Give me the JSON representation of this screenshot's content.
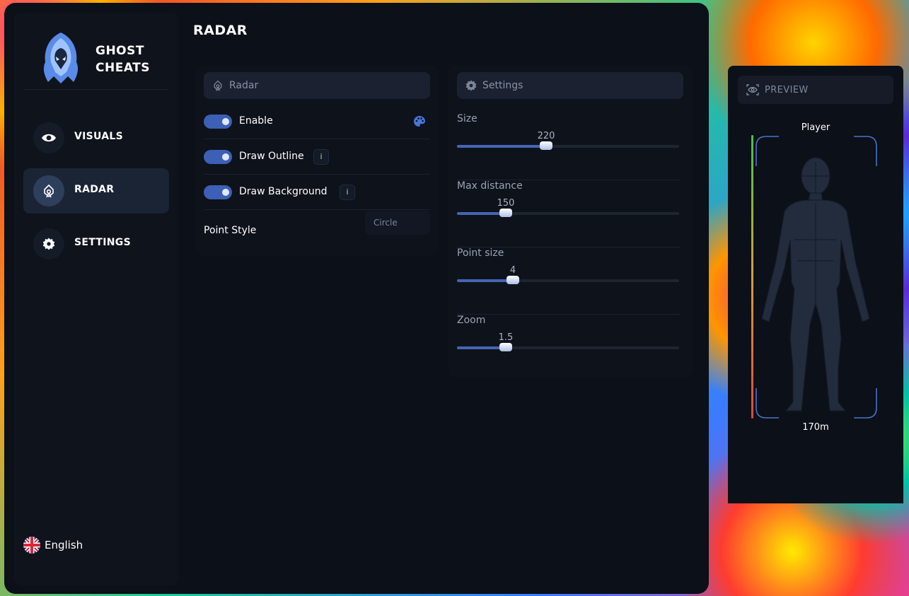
{
  "brand": {
    "name": "GHOST CHEATS",
    "accent": "#4565b4"
  },
  "sidebar": {
    "items": [
      {
        "label": "VISUALS",
        "icon": "eye-icon",
        "active": false
      },
      {
        "label": "RADAR",
        "icon": "radar-icon",
        "active": true
      },
      {
        "label": "SETTINGS",
        "icon": "gear-icon",
        "active": false
      }
    ],
    "language": {
      "label": "English",
      "icon": "uk-flag-icon"
    }
  },
  "page": {
    "title": "RADAR"
  },
  "radar_panel": {
    "header": "Radar",
    "options": [
      {
        "label": "Enable",
        "enabled": true,
        "extra": "palette-icon"
      },
      {
        "label": "Draw Outline",
        "enabled": true,
        "extra": "info-icon",
        "info": "i"
      },
      {
        "label": "Draw Background",
        "enabled": true,
        "extra": "info-icon",
        "info": "i"
      }
    ],
    "point_style": {
      "label": "Point Style",
      "value": "Circle"
    }
  },
  "settings_panel": {
    "header": "Settings",
    "sliders": [
      {
        "label": "Size",
        "value": "220",
        "fraction": 0.4
      },
      {
        "label": "Max distance",
        "value": "150",
        "fraction": 0.22
      },
      {
        "label": "Point size",
        "value": "4",
        "fraction": 0.25
      },
      {
        "label": "Zoom",
        "value": "1.5",
        "fraction": 0.22
      }
    ]
  },
  "preview": {
    "header": "PREVIEW",
    "player_name": "Player",
    "distance": "170m",
    "health_colors": [
      "#45c24e",
      "#e04545"
    ]
  }
}
